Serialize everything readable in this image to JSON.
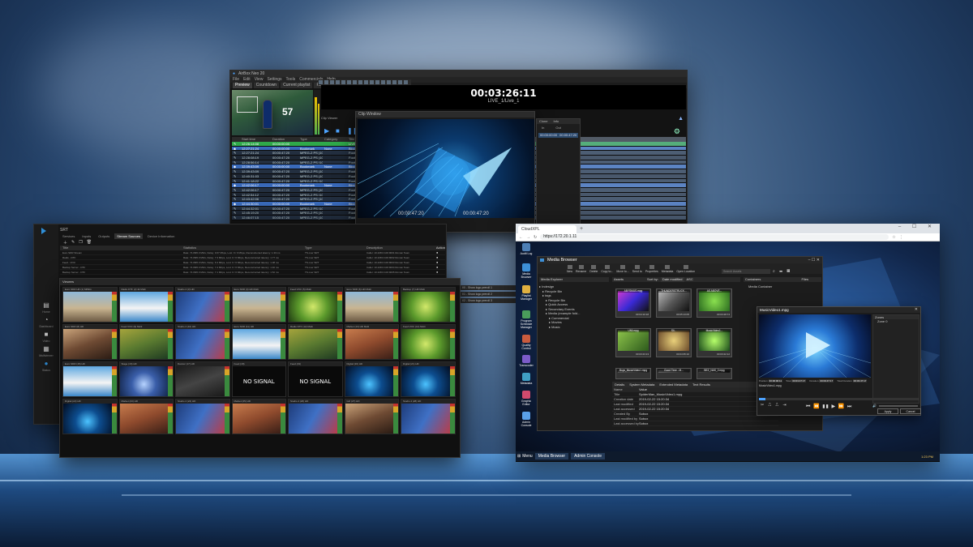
{
  "playout": {
    "window_title": "AirBox Neo 20",
    "menu": [
      "File",
      "Edit",
      "View",
      "Settings",
      "Tools",
      "Commercials",
      "Help"
    ],
    "tabs": [
      "Preview",
      "Countdown",
      "Current playlist",
      "Replace"
    ],
    "clock": "00:03:26:11",
    "live_label": "LIVE_1/Live_1",
    "clip_viewer_label": "Clip Viewer",
    "score_overlay": "57",
    "columns": [
      "",
      "Start time",
      "Duration",
      "Type",
      "Category",
      "Title"
    ],
    "rows": [
      {
        "start": "12:26:14:08",
        "dur": "00:00:00:00",
        "type": "",
        "cat": "",
        "title": "LIVE_1",
        "style": "green"
      },
      {
        "start": "12:27:21:24",
        "dur": "00:00:00:00",
        "type": "Bookmark",
        "cat": "None",
        "title": "Block",
        "style": "blue"
      },
      {
        "start": "12:27:21:24",
        "dur": "00:00:47:20",
        "type": "MPEG-2 PS (1080i)",
        "cat": "",
        "title": "FootBa",
        "style": ""
      },
      {
        "start": "12:28:08:19",
        "dur": "00:00:47:20",
        "type": "MPEG-2 PS (1080i)",
        "cat": "",
        "title": "FootBa",
        "style": ""
      },
      {
        "start": "12:28:56:14",
        "dur": "00:00:47:20",
        "type": "MPEG-2 PS (1080i)",
        "cat": "",
        "title": "FootBa",
        "style": ""
      },
      {
        "start": "12:39:43:09",
        "dur": "00:00:00:00",
        "type": "Bookmark",
        "cat": "None",
        "title": "Block",
        "style": "blue"
      },
      {
        "start": "12:39:43:09",
        "dur": "00:00:47:20",
        "type": "MPEG-2 PS (1080i)",
        "cat": "",
        "title": "FootBa",
        "style": ""
      },
      {
        "start": "12:40:31:03",
        "dur": "00:00:47:20",
        "type": "MPEG-2 PS (1080i)",
        "cat": "",
        "title": "FootBa",
        "style": ""
      },
      {
        "start": "12:41:18:22",
        "dur": "00:00:47:20",
        "type": "MPEG-2 PS (1080i)",
        "cat": "",
        "title": "FootBa",
        "style": ""
      },
      {
        "start": "12:42:06:17",
        "dur": "00:00:00:00",
        "type": "Bookmark",
        "cat": "None",
        "title": "Block",
        "style": "blue"
      },
      {
        "start": "12:42:06:17",
        "dur": "00:00:47:20",
        "type": "MPEG-2 PS (1080i)",
        "cat": "",
        "title": "FootBa",
        "style": ""
      },
      {
        "start": "12:42:54:12",
        "dur": "00:00:47:20",
        "type": "MPEG-2 PS (1080i)",
        "cat": "",
        "title": "FootBa",
        "style": ""
      },
      {
        "start": "12:43:42:06",
        "dur": "00:00:47:20",
        "type": "MPEG-2 PS (1080i)",
        "cat": "",
        "title": "FootBa",
        "style": ""
      },
      {
        "start": "12:44:30:01",
        "dur": "00:00:00:00",
        "type": "Bookmark",
        "cat": "None",
        "title": "Block",
        "style": "blue"
      },
      {
        "start": "12:44:32:01",
        "dur": "00:00:47:20",
        "type": "MPEG-2 PS (1080i)",
        "cat": "",
        "title": "FootBa",
        "style": ""
      },
      {
        "start": "12:45:19:20",
        "dur": "00:00:47:20",
        "type": "MPEG-2 PS (1080i)",
        "cat": "",
        "title": "FootBa",
        "style": ""
      },
      {
        "start": "12:46:07:15",
        "dur": "00:00:47:20",
        "type": "MPEG-2 PS (1080i)",
        "cat": "",
        "title": "FootBa",
        "style": ""
      }
    ]
  },
  "clip_window": {
    "title": "Clip Window",
    "timecode_left": "00:00:47:20",
    "timecode_right": "00:00:47:20",
    "side_tabs": [
      "Clone",
      "Info"
    ],
    "side_headers": [
      "In",
      "Out"
    ],
    "side_values": [
      "00:00:00:00",
      "00:00:47:20"
    ]
  },
  "multiviewer_app": {
    "title": "SRT",
    "tabs": [
      "Services",
      "Inputs",
      "Outputs",
      "Stream Sources",
      "Device Information"
    ],
    "active_tab": "Stream Sources",
    "nav": [
      "Home",
      "Dashboard",
      "Video",
      "Multiviewer",
      "Status"
    ],
    "table_headers": [
      "Title",
      "Statistics",
      "Type",
      "Description",
      "Action"
    ],
    "table_rows": [
      {
        "title": "Euro SDR Stream",
        "stats": "Rate: 74.08/0.0 Mb/s, Delay: 0.67 Mbps, Lost: 0 / 0 Mbps, Reconstructed latency: 1.33 ms",
        "type": "TS over SRT",
        "desc": "Caller: 10.228.0.100:9001 Roman Team"
      },
      {
        "title": "Radio - DTF",
        "stats": "Rate: 74.08/0.0 Mb/s, Delay: 7.3 Mbps, Lost: 0 / 0 Mbps, Reconstructed latency: 1.77 ms",
        "type": "TS over SRT",
        "desc": "Caller: 10.228.0.100:9002 Roman Team"
      },
      {
        "title": "Feed - VOC",
        "stats": "Rate: 74.08/0.0 Mb/s, Delay: 6.3 Mbps, Lost: 0 / 0 Mbps, Reconstructed latency: 1.38 ms",
        "type": "TS over SRT",
        "desc": "Caller: 10.228.0.100:9003 Roman Team"
      },
      {
        "title": "Backup Server - DTF",
        "stats": "Rate: 74.08/0.0 Mb/s, Delay: 7.4 Mbps, Lost: 0 / 0 Mbps, Reconstructed latency: 1.40 ms",
        "type": "TS over SRT",
        "desc": "Caller: 10.228.0.100:9004 Roman Team"
      },
      {
        "title": "Backup Server - DTF",
        "stats": "Rate: 74.08/0.0 Mb/s, Delay: 7.1 Mbps, Lost: 0 / 0 Mbps, Reconstructed latency: 1.52 ms",
        "type": "TS over SRT",
        "desc": "Caller: 10.228.0.100:9005 Roman Team"
      }
    ],
    "overlay_labels": [
      "I/0 - Show logo preroll 1",
      "I/1 - Show logo preroll 2",
      "I/2 - Show logo preroll 3"
    ],
    "panel_title": "Viewers",
    "tiles": [
      {
        "label": "Euro SDR HD (1) MPEG",
        "kind": "t-city"
      },
      {
        "label": "Radio DTF (2) 4k Multi",
        "kind": "t-church"
      },
      {
        "label": "Studio 4 (3) HD",
        "kind": "t-studio"
      },
      {
        "label": "Euro SDR (4) HD Multi",
        "kind": "t-city"
      },
      {
        "label": "Feed VOC (5) Multi",
        "kind": "t-leaf"
      },
      {
        "label": "Euro SDR (6) HD Multi",
        "kind": "t-city"
      },
      {
        "label": "Backup (7) HD Multi",
        "kind": "t-leaf"
      },
      {
        "label": "Euro SDR (8) HD",
        "kind": "t-girl"
      },
      {
        "label": "Feed VOC (9) Multi",
        "kind": "t-fish"
      },
      {
        "label": "Studio 4 (10) HD",
        "kind": "t-studio"
      },
      {
        "label": "Euro SDR (11) HD",
        "kind": "t-church"
      },
      {
        "label": "Radio DTF (12) Multi",
        "kind": "t-fish"
      },
      {
        "label": "Market (13) HD Multi",
        "kind": "t-market"
      },
      {
        "label": "Feed VOC (14) Multi",
        "kind": "t-leaf"
      },
      {
        "label": "Euro SDR (15) HD",
        "kind": "t-church"
      },
      {
        "label": "Stage (16) HD",
        "kind": "t-stage"
      },
      {
        "label": "Dancer (17) HD",
        "kind": "t-dancer"
      },
      {
        "label": "Feed (18)",
        "kind": "nosignal"
      },
      {
        "label": "Feed (19)",
        "kind": "nosignal"
      },
      {
        "label": "Digital (20) HD",
        "kind": "t-digital"
      },
      {
        "label": "Digital (21) HD",
        "kind": "t-digital"
      },
      {
        "label": "Digital (22) HD",
        "kind": "t-digital"
      },
      {
        "label": "Market (23) HD",
        "kind": "t-market"
      },
      {
        "label": "Studio 4 (24) HD",
        "kind": "t-studio"
      },
      {
        "label": "Market (25) HD",
        "kind": "t-market"
      },
      {
        "label": "Studio 4 (26) HD",
        "kind": "t-studio"
      },
      {
        "label": "Girl (27) HD",
        "kind": "t-girl"
      },
      {
        "label": "Studio 4 (28) HD",
        "kind": "t-studio"
      }
    ],
    "no_signal_text": "NO SIGNAL"
  },
  "cloud": {
    "tab_title": "CloudXPL",
    "url": "https://172.20.1.11",
    "desktop_icons": [
      "Audit Log",
      "Media Browser",
      "Playlist Manager",
      "Program Schedule Manager",
      "Quality Control",
      "Transcoder",
      "Metadata",
      "Graphic Editor",
      "Admin Console"
    ],
    "taskbar": {
      "menu": "Menu",
      "items": [
        "Media Browser",
        "Admin Console"
      ],
      "tray": "1:23 PM"
    },
    "media_browser": {
      "title": "Media Browser",
      "tools": [
        "New",
        "Rename",
        "Delete",
        "Copy to...",
        "Move to...",
        "Send to",
        "Properties",
        "Metadata",
        "Open Location"
      ],
      "explorer_title": "Media Explorer",
      "assets_title": "Assets",
      "sort_label": "Sort by:",
      "sort_value": "Date modified",
      "sort_order": "ASC",
      "search_placeholder": "Search Assets",
      "containers_title": "Containers",
      "files_label": "Files",
      "tree": [
        "Indesign",
        "Recycle Bin",
        "tags",
        "Recycle Bin",
        "Quick Access",
        "Secondary Events",
        "Media (example fold...",
        "Commercial",
        "Movies",
        "Music"
      ],
      "container_tree": [
        "Media Container"
      ],
      "thumbs": [
        {
          "name": "ABYSMUS.mpg",
          "dur": "00:04:10:18"
        },
        {
          "name": "THUNDERSTRUCK...",
          "dur": "00:05:13:05"
        },
        {
          "name": "AS ABOVE...",
          "dur": "00:03:28:74"
        },
        {
          "name": "UMI.mpg",
          "dur": "00:03:23:13"
        },
        {
          "name": "Sli...",
          "dur": "00:04:35:10"
        },
        {
          "name": "MusicVideo1...",
          "dur": "00:03:22:12"
        },
        {
          "name": "Boys_MusicVideo1.mpg",
          "dur": ""
        },
        {
          "name": "Good Time - M...",
          "dur": ""
        },
        {
          "name": "BEZ_NAS_2.mpg",
          "dur": ""
        }
      ],
      "detail_tabs": [
        "Details",
        "System Metadata",
        "Extended Metadata",
        "Text Results"
      ],
      "detail_head": [
        "Name",
        "Value"
      ],
      "details": [
        {
          "k": "Title",
          "v": "SpiderMan_MusicVideo1.mpg"
        },
        {
          "k": "Creation date",
          "v": "2019-02-22 15:20:34"
        },
        {
          "k": "Last modified",
          "v": "2019-02-22 15:20:34"
        },
        {
          "k": "Last accessed",
          "v": "2019-02-22 15:20:34"
        },
        {
          "k": "Created By",
          "v": "Sobox"
        },
        {
          "k": "Last modified by",
          "v": "Sobox"
        },
        {
          "k": "Last accessed by",
          "v": "Sobox"
        }
      ]
    },
    "player": {
      "title": "MusicVideo1.mpg",
      "side_items": [
        "Zones",
        "Zone 0"
      ],
      "info": [
        {
          "k": "Position",
          "v": "00:00:00:11"
        },
        {
          "k": "Total",
          "v": "00:03:47:17"
        },
        {
          "k": "Duration",
          "v": "00:03:47:17"
        },
        {
          "k": "Total Duration",
          "v": "00:03:47:17"
        }
      ],
      "filename": "MusicVideo1.mpg",
      "controls": "⏮ ⏪ ▮▮ ▶ ⏩ ⏭",
      "apply": "Apply",
      "cancel": "Cancel"
    }
  }
}
